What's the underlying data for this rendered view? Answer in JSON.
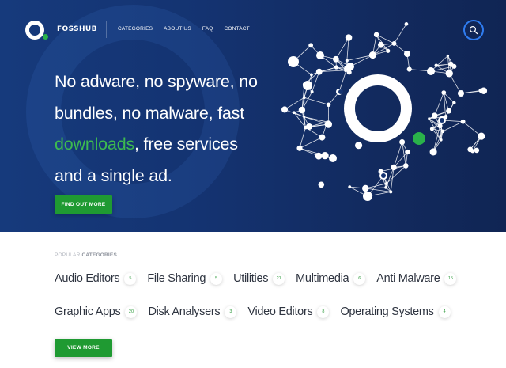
{
  "brand": {
    "name": "FOSSHUB",
    "accent": "#2ab24a",
    "link_blue": "#2f7cf0"
  },
  "nav": [
    {
      "label": "CATEGORIES"
    },
    {
      "label": "ABOUT US"
    },
    {
      "label": "FAQ"
    },
    {
      "label": "CONTACT"
    }
  ],
  "search": {
    "icon": "search-icon"
  },
  "hero": {
    "line1": "No adware, no spyware, no",
    "line2": "bundles, no malware, fast",
    "line3_highlight": "downloads",
    "line3_rest": ", free services",
    "line4": "and a single ad.",
    "button": "FIND OUT MORE",
    "background": "#143371",
    "highlight_color": "#3dbb4f"
  },
  "popular": {
    "label_light": "POPULAR",
    "label_bold": "CATEGORIES",
    "rows": [
      [
        {
          "name": "Audio Editors",
          "count": "5"
        },
        {
          "name": "File Sharing",
          "count": "5"
        },
        {
          "name": "Utilities",
          "count": "21"
        },
        {
          "name": "Multimedia",
          "count": "6"
        },
        {
          "name": "Anti Malware",
          "count": "15"
        }
      ],
      [
        {
          "name": "Graphic Apps",
          "count": "20"
        },
        {
          "name": "Disk Analysers",
          "count": "3"
        },
        {
          "name": "Video Editors",
          "count": "8"
        },
        {
          "name": "Operating Systems",
          "count": "4"
        }
      ]
    ],
    "button": "VIEW MORE"
  }
}
